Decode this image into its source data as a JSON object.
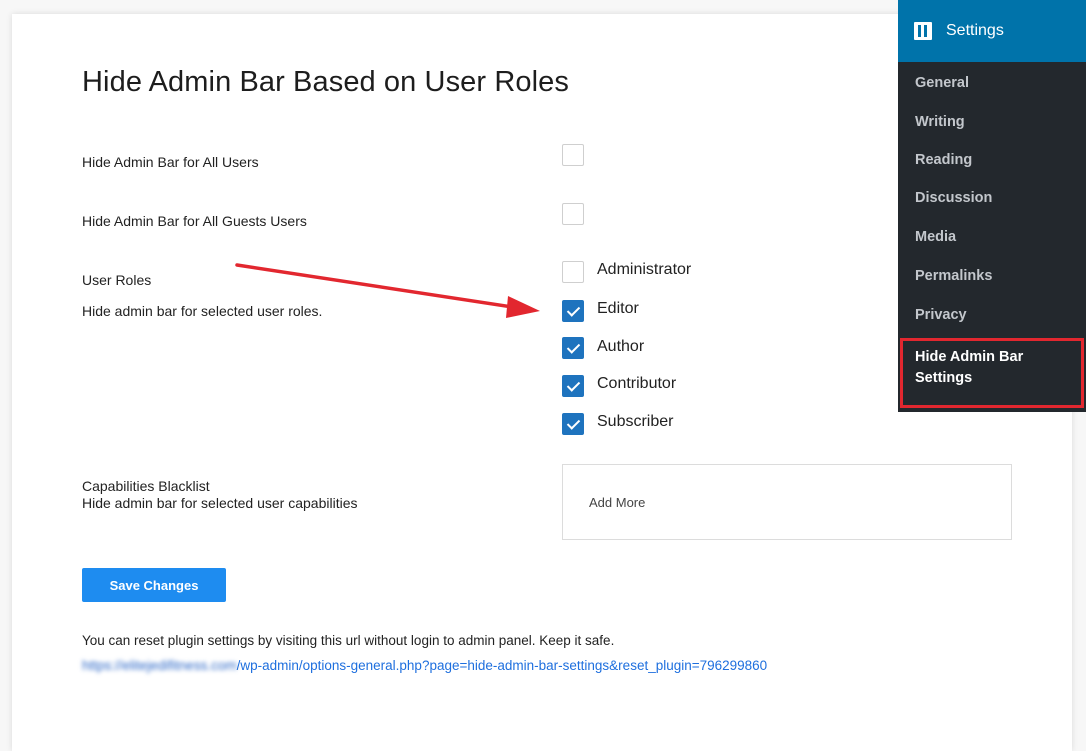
{
  "page": {
    "title": "Hide Admin Bar Based on User Roles"
  },
  "fields": {
    "all_users_label": "Hide Admin Bar for All Users",
    "all_guests_label": "Hide Admin Bar for All Guests Users",
    "user_roles_label": "User Roles",
    "user_roles_desc": "Hide admin bar for selected user roles.",
    "capabilities_label": "Capabilities Blacklist",
    "capabilities_desc": "Hide admin bar for selected user capabilities",
    "capabilities_placeholder": "Add More"
  },
  "checkboxes": {
    "all_users": false,
    "all_guests": false
  },
  "roles": [
    {
      "label": "Administrator",
      "checked": false
    },
    {
      "label": "Editor",
      "checked": true
    },
    {
      "label": "Author",
      "checked": true
    },
    {
      "label": "Contributor",
      "checked": true
    },
    {
      "label": "Subscriber",
      "checked": true
    }
  ],
  "actions": {
    "save_label": "Save Changes"
  },
  "reset": {
    "text": "You can reset plugin settings by visiting this url without login to admin panel. Keep it safe.",
    "url_blurred": "https://elitejedifitness.com",
    "url_visible": "/wp-admin/options-general.php?page=hide-admin-bar-settings&reset_plugin=796299860"
  },
  "sidebar": {
    "title": "Settings",
    "icon": "settings-icon",
    "items": [
      {
        "label": "General"
      },
      {
        "label": "Writing"
      },
      {
        "label": "Reading"
      },
      {
        "label": "Discussion"
      },
      {
        "label": "Media"
      },
      {
        "label": "Permalinks"
      },
      {
        "label": "Privacy"
      }
    ],
    "active_item": {
      "line1": "Hide Admin Bar",
      "line2": "Settings"
    }
  },
  "colors": {
    "accent": "#1e73be",
    "button": "#1e8cf0",
    "sidebar_bg": "#23282d",
    "sidebar_header": "#0073aa",
    "annotation": "#e2272f"
  }
}
